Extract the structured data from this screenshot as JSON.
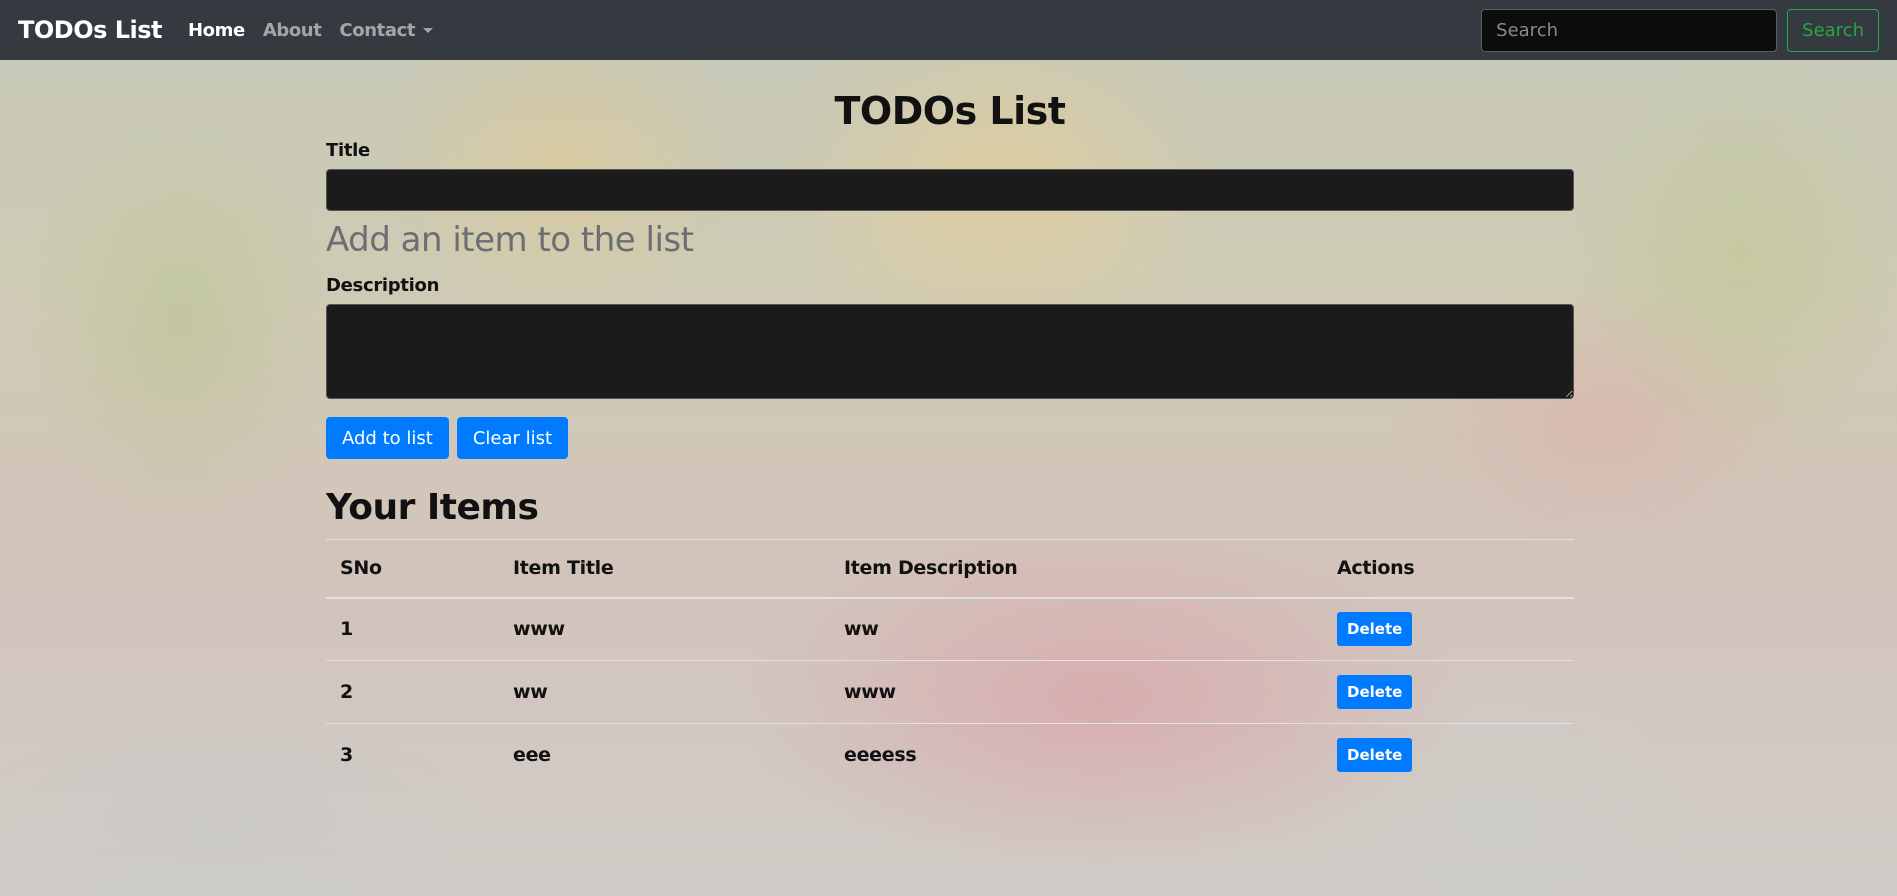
{
  "navbar": {
    "brand": "TODOs List",
    "links": [
      "Home",
      "About",
      "Contact"
    ],
    "search_placeholder": "Search",
    "search_button": "Search"
  },
  "main": {
    "title": "TODOs List",
    "title_label": "Title",
    "subheading": "Add an item to the list",
    "description_label": "Description",
    "add_button": "Add to list",
    "clear_button": "Clear list",
    "items_heading": "Your Items",
    "table": {
      "headers": [
        "SNo",
        "Item Title",
        "Item Description",
        "Actions"
      ],
      "rows": [
        {
          "sno": "1",
          "title": "www",
          "description": "ww",
          "action": "Delete"
        },
        {
          "sno": "2",
          "title": "ww",
          "description": "www",
          "action": "Delete"
        },
        {
          "sno": "3",
          "title": "eee",
          "description": "eeeess",
          "action": "Delete"
        }
      ]
    }
  },
  "colors": {
    "navbar_bg": "#343a40",
    "primary": "#007bff",
    "success": "#28a745"
  }
}
